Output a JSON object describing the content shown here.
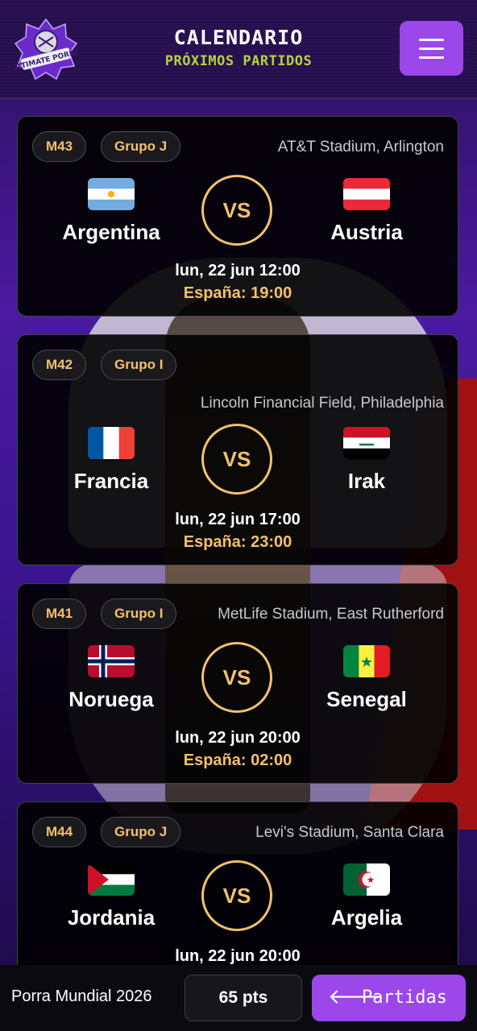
{
  "header": {
    "logo_text": "ULTIMATE PORRA",
    "title": "CALENDARIO",
    "subtitle": "PRÓXIMOS PARTIDOS"
  },
  "matches": [
    {
      "code": "M43",
      "group": "Grupo J",
      "venue": "AT&T Stadium, Arlington",
      "home": {
        "name": "Argentina",
        "flag": "argentina-flag"
      },
      "away": {
        "name": "Austria",
        "flag": "austria-flag"
      },
      "vs": "VS",
      "date": "lun, 22 jun 12:00",
      "spain_time": "España: 19:00"
    },
    {
      "code": "M42",
      "group": "Grupo I",
      "venue": "Lincoln Financial Field, Philadelphia",
      "home": {
        "name": "Francia",
        "flag": "france-flag"
      },
      "away": {
        "name": "Irak",
        "flag": "iraq-flag"
      },
      "vs": "VS",
      "date": "lun, 22 jun 17:00",
      "spain_time": "España: 23:00"
    },
    {
      "code": "M41",
      "group": "Grupo I",
      "venue": "MetLife Stadium, East Rutherford",
      "home": {
        "name": "Noruega",
        "flag": "norway-flag"
      },
      "away": {
        "name": "Senegal",
        "flag": "senegal-flag"
      },
      "vs": "VS",
      "date": "lun, 22 jun 20:00",
      "spain_time": "España: 02:00"
    },
    {
      "code": "M44",
      "group": "Grupo J",
      "venue": "Levi's Stadium, Santa Clara",
      "home": {
        "name": "Jordania",
        "flag": "jordan-flag"
      },
      "away": {
        "name": "Argelia",
        "flag": "algeria-flag"
      },
      "vs": "VS",
      "date": "lun, 22 jun 20:00",
      "spain_time": ""
    }
  ],
  "footer": {
    "app_name": "Porra Mundial 2026",
    "points": "65 pts",
    "partidas_arrow": "🡐",
    "partidas_label": "Partidas"
  },
  "colors": {
    "accent_purple": "#9b47ea",
    "gold": "#f3c16d",
    "lime": "#b7d23a",
    "header_bg": "#260e4f"
  }
}
